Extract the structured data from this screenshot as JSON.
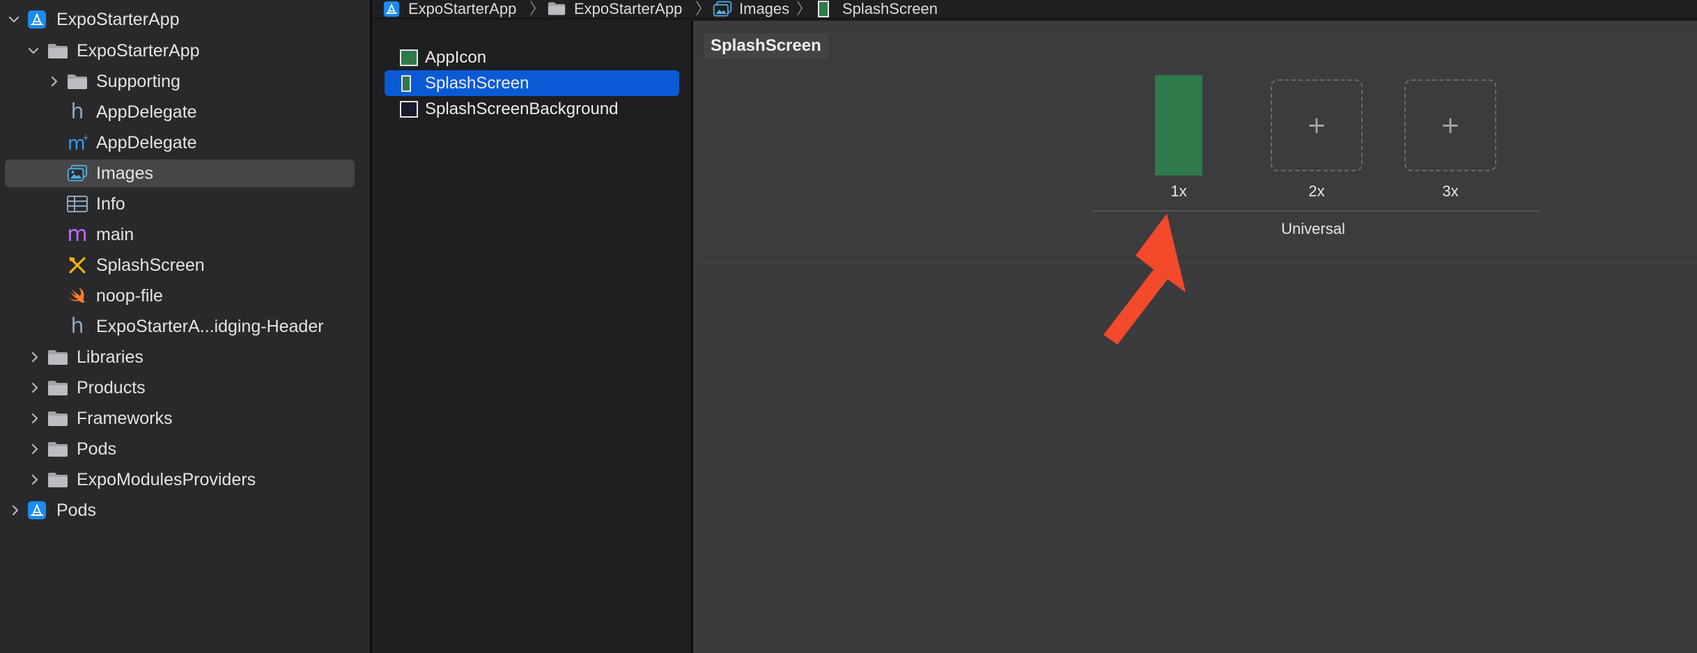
{
  "navigator": {
    "items": [
      {
        "label": "ExpoStarterApp",
        "icon": "app-project-icon",
        "chevron": "down"
      },
      {
        "label": "ExpoStarterApp",
        "icon": "folder-icon",
        "chevron": "down"
      },
      {
        "label": "Supporting",
        "icon": "folder-icon",
        "chevron": "right"
      },
      {
        "label": "AppDelegate",
        "icon": "header-file-icon"
      },
      {
        "label": "AppDelegate",
        "icon": "objc-file-icon"
      },
      {
        "label": "Images",
        "icon": "asset-catalog-icon",
        "selected": true
      },
      {
        "label": "Info",
        "icon": "plist-icon"
      },
      {
        "label": "main",
        "icon": "objc-m-file-icon"
      },
      {
        "label": "SplashScreen",
        "icon": "storyboard-icon"
      },
      {
        "label": "noop-file",
        "icon": "swift-icon"
      },
      {
        "label": "ExpoStarterA...idging-Header",
        "icon": "header-file-icon"
      },
      {
        "label": "Libraries",
        "icon": "folder-icon",
        "chevron": "right"
      },
      {
        "label": "Products",
        "icon": "folder-icon",
        "chevron": "right"
      },
      {
        "label": "Frameworks",
        "icon": "folder-icon",
        "chevron": "right"
      },
      {
        "label": "Pods",
        "icon": "folder-icon",
        "chevron": "right"
      },
      {
        "label": "ExpoModulesProviders",
        "icon": "folder-icon",
        "chevron": "right"
      },
      {
        "label": "Pods",
        "icon": "app-project-icon",
        "chevron": "right"
      }
    ]
  },
  "jumpbar": {
    "crumbs": [
      "ExpoStarterApp",
      "ExpoStarterApp",
      "Images",
      "SplashScreen"
    ],
    "separator": "〉"
  },
  "assets": {
    "items": [
      {
        "label": "AppIcon",
        "icon": "app-icon-set-icon"
      },
      {
        "label": "SplashScreen",
        "icon": "image-set-icon",
        "selected": true
      },
      {
        "label": "SplashScreenBackground",
        "icon": "color-set-icon"
      }
    ]
  },
  "editor": {
    "set_title": "SplashScreen",
    "slots": [
      {
        "label": "1x",
        "filled": true
      },
      {
        "label": "2x",
        "filled": false,
        "placeholder": "+"
      },
      {
        "label": "3x",
        "filled": false,
        "placeholder": "+"
      }
    ],
    "group_label": "Universal"
  },
  "colors": {
    "selection_blue": "#0a5ad6",
    "image_green": "#2e7a4a",
    "annotation_arrow": "#f24a2a",
    "app_icon_blue": "#1a8cf0"
  }
}
